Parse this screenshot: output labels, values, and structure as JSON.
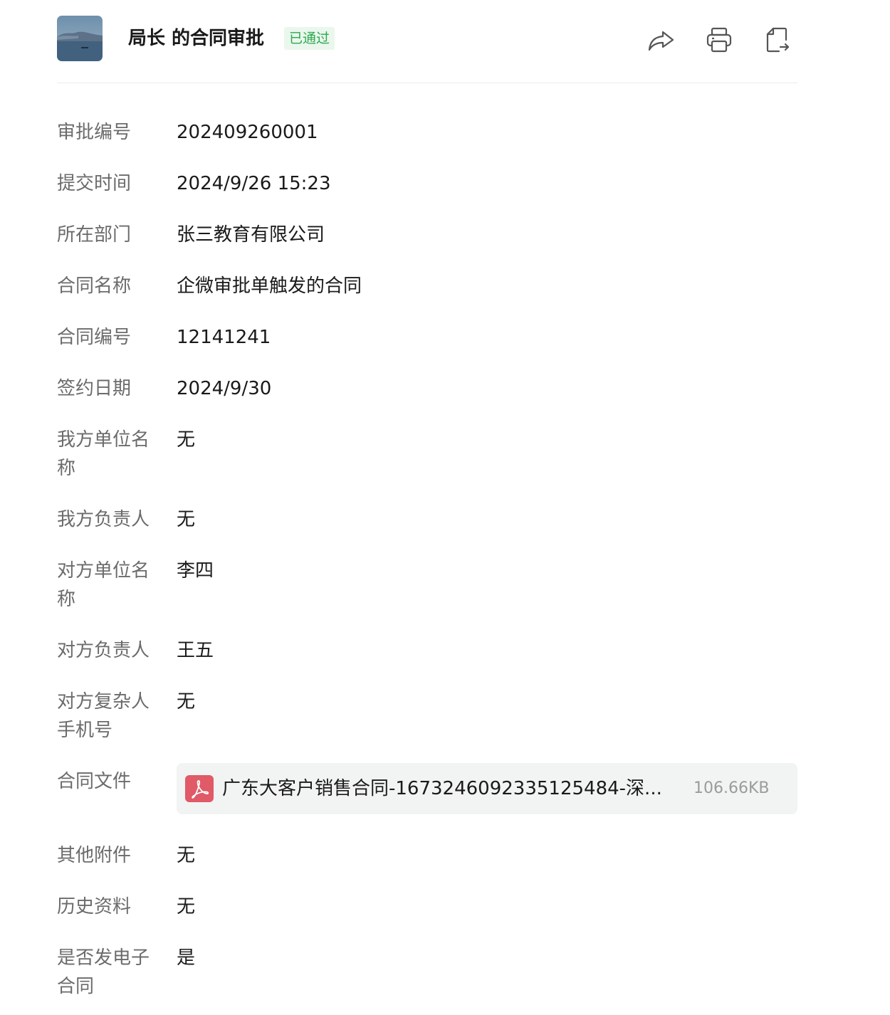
{
  "header": {
    "title": "局长 的合同审批",
    "status": "已通过",
    "status_color": "#2fa84f",
    "actions": [
      {
        "name": "share-icon"
      },
      {
        "name": "print-icon"
      },
      {
        "name": "export-icon"
      }
    ]
  },
  "fields": {
    "approval_no": {
      "label": "审批编号",
      "value": "202409260001"
    },
    "submit_time": {
      "label": "提交时间",
      "value": "2024/9/26 15:23"
    },
    "department": {
      "label": "所在部门",
      "value": "张三教育有限公司"
    },
    "contract_name": {
      "label": "合同名称",
      "value": "企微审批单触发的合同"
    },
    "contract_no": {
      "label": "合同编号",
      "value": "12141241"
    },
    "sign_date": {
      "label": "签约日期",
      "value": "2024/9/30"
    },
    "our_company": {
      "label": "我方单位名称",
      "value": "无"
    },
    "our_person": {
      "label": "我方负责人",
      "value": "无"
    },
    "their_company": {
      "label": "对方单位名称",
      "value": "李四"
    },
    "their_person": {
      "label": "对方负责人",
      "value": "王五"
    },
    "their_phone": {
      "label": "对方复杂人手机号",
      "value": "无"
    },
    "contract_file": {
      "label": "合同文件",
      "file_name": "广东大客户销售合同-1673246092335125484-深...",
      "file_size": "106.66KB",
      "file_icon": "pdf-icon"
    },
    "other_attachments": {
      "label": "其他附件",
      "value": "无"
    },
    "history": {
      "label": "历史资料",
      "value": "无"
    },
    "e_contract": {
      "label": "是否发电子合同",
      "value": "是"
    }
  }
}
